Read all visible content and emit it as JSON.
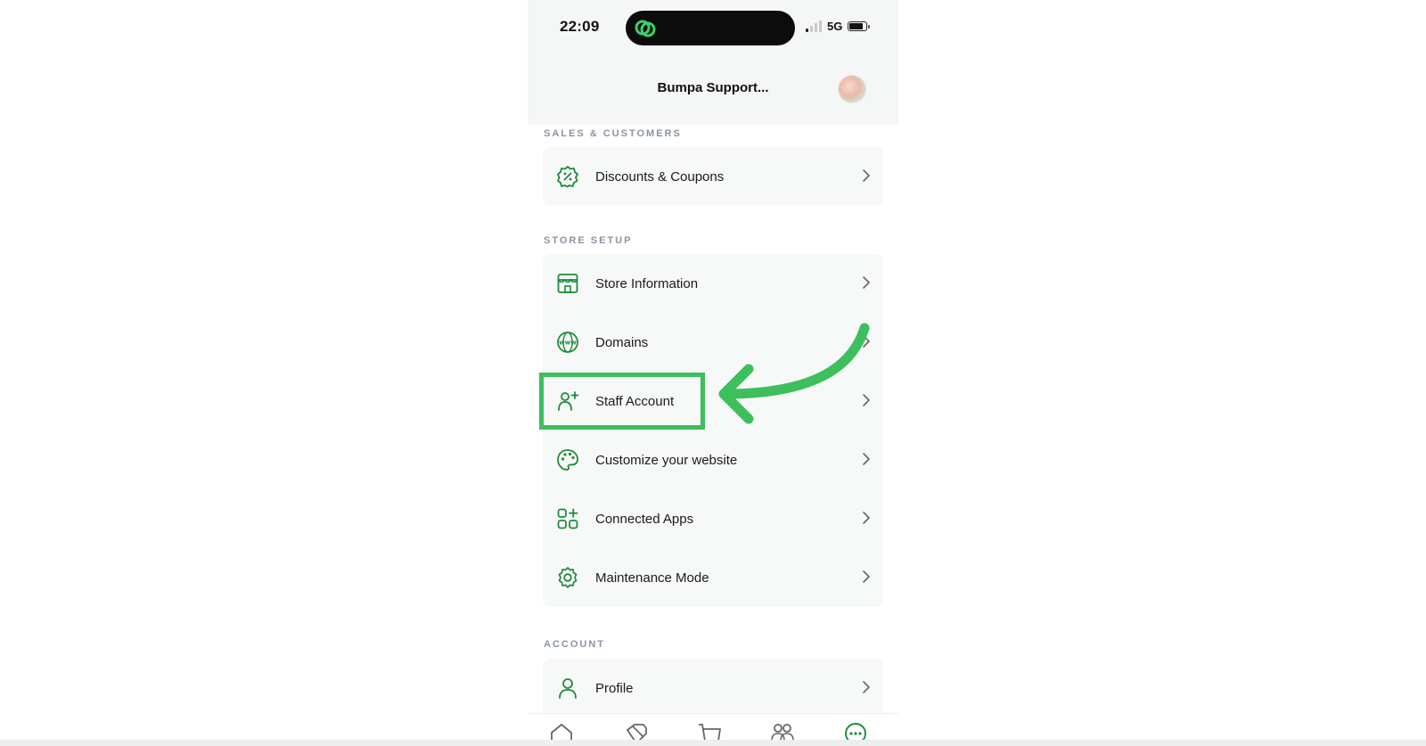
{
  "status_bar": {
    "time": "22:09",
    "network": "5G"
  },
  "header": {
    "title": "Bumpa Support..."
  },
  "sections": [
    {
      "label": "SALES & CUSTOMERS",
      "items": [
        {
          "label": "Discounts & Coupons",
          "icon": "discount-badge-icon"
        }
      ]
    },
    {
      "label": "STORE SETUP",
      "items": [
        {
          "label": "Store Information",
          "icon": "storefront-icon"
        },
        {
          "label": "Domains",
          "icon": "globe-www-icon"
        },
        {
          "label": "Staff Account",
          "icon": "user-add-icon"
        },
        {
          "label": "Customize your website",
          "icon": "palette-icon"
        },
        {
          "label": "Connected Apps",
          "icon": "apps-grid-plus-icon"
        },
        {
          "label": "Maintenance Mode",
          "icon": "gear-icon"
        }
      ]
    },
    {
      "label": "ACCOUNT",
      "items": [
        {
          "label": "Profile",
          "icon": "user-icon"
        }
      ]
    }
  ],
  "tabbar": [
    "home-icon",
    "tag-icon",
    "cart-icon",
    "customers-icon",
    "more-icon"
  ],
  "colors": {
    "brand_green": "#1f8a3b",
    "annotation_green": "#3cbf5c",
    "header_bg": "#f5f7f6",
    "card_bg": "#f7f8f8",
    "section_label": "#8a94a0"
  }
}
